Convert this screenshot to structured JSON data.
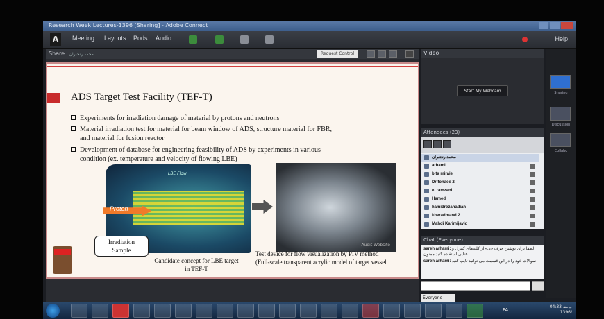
{
  "window": {
    "title": "Research Week Lectures-1396 [Sharing] - Adobe Connect"
  },
  "menu": {
    "logo": "A",
    "items": [
      "Meeting",
      "Layouts",
      "Pods",
      "Audio"
    ],
    "help": "Help"
  },
  "share_pod": {
    "title": "Share",
    "owner": "محمد رنجبران",
    "request_control": "Request Control"
  },
  "slide": {
    "title": "ADS Target Test Facility (TEF-T)",
    "bullets": [
      "Experiments for irradiation damage of material by protons and neutrons",
      "Material irradiation test for material for beam window of ADS, structure material for FBR,",
      "and material for fusion reactor",
      "Development of database for engineering feasibility of ADS by experiments in various",
      "condition (ex. temperature and velocity of flowing LBE)"
    ],
    "flow_label": "LBE Flow",
    "proton_label": "Proton",
    "callout_line1": "Irradiation",
    "callout_line2": "Sample",
    "caption_left_1": "Candidate concept for LBE target",
    "caption_left_2": "in TEF-T",
    "caption_right_1": "Test device for flow visualization by PIV method",
    "caption_right_2": "(Full-scale transparent acrylic model of target vessel",
    "watermark": "Audit Website"
  },
  "video_pod": {
    "title": "Video",
    "webcam_button": "Start My Webcam"
  },
  "attendees_pod": {
    "title": "Attendees",
    "count": "(23)",
    "host": "محمد رنجبران",
    "names": [
      "arhami",
      "bita miraie",
      "Dr fonaee 2",
      "e. ramzani",
      "Hamed",
      "hamidrezahadian",
      "kheradmand 2",
      "Mahdi Karimijavid"
    ]
  },
  "chat_pod": {
    "title": "Chat",
    "scope": "(Everyone)",
    "messages": [
      {
        "who": "sareh arhami:",
        "text": "لطفا برای نوشتن حرف «ی» از کلیدهای کنترل و عنایی استفاده کنید ممنون"
      },
      {
        "who": "sareh arhami:",
        "text": "سوالات خود را در این قسمت می توانید تایپ کنید"
      }
    ],
    "to": "Everyone"
  },
  "layouts": {
    "items": [
      "Sharing",
      "Discussion",
      "Collabo"
    ]
  },
  "tray": {
    "lang": "FA",
    "time": "04:33 ب.ظ",
    "date": "1396/"
  }
}
